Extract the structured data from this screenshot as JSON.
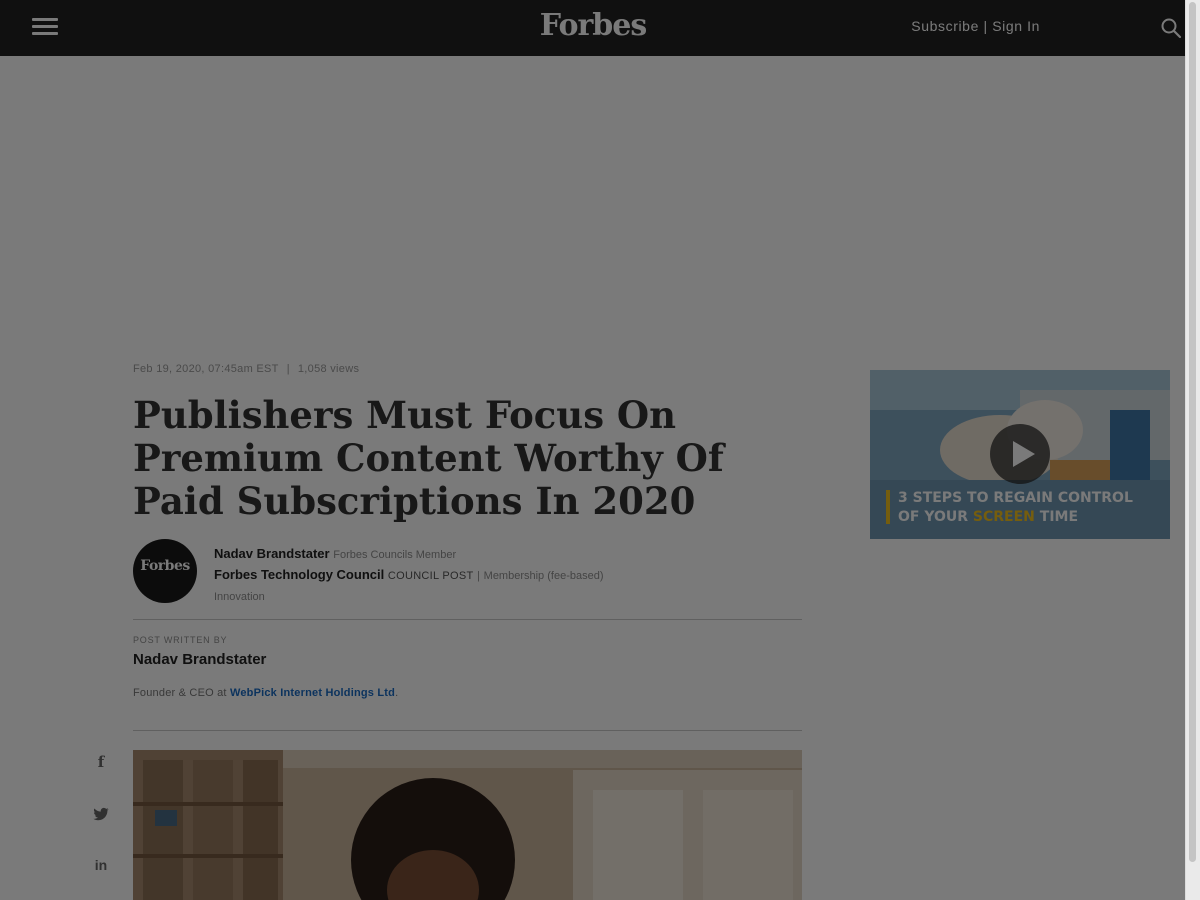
{
  "header": {
    "logo": "Forbes",
    "subscribe_label": "Subscribe",
    "auth_separator": "|",
    "signin_label": "Sign In"
  },
  "article": {
    "date": "Feb 19, 2020, 07:45am EST",
    "meta_separator": "|",
    "views": "1,058 views",
    "title": "Publishers Must Focus On Premium Content Worthy Of Paid Subscriptions In 2020",
    "author": {
      "avatar_logo": "Forbes",
      "name": "Nadav Brandstater",
      "role": "Forbes Councils Member",
      "council": "Forbes Technology Council",
      "post_type": "COUNCIL POST",
      "membership_separator": "|",
      "membership": "Membership (fee-based)",
      "channel": "Innovation"
    },
    "written_by_label": "POST WRITTEN BY",
    "written_by_name": "Nadav Brandstater",
    "bio_prefix": "Founder & CEO at",
    "bio_company": "WebPick Internet Holdings Ltd",
    "bio_suffix": "."
  },
  "video_ad": {
    "caption_line1": "3 STEPS TO REGAIN CONTROL",
    "caption_line2_prefix": "OF YOUR",
    "caption_line2_highlight": "SCREEN",
    "caption_line2_suffix": "TIME"
  },
  "icons": {
    "menu": "hamburger-icon",
    "search": "search-icon",
    "play": "play-icon",
    "facebook": "facebook-icon",
    "twitter": "twitter-icon",
    "linkedin": "linkedin-icon"
  },
  "colors": {
    "topbar": "#222222",
    "link": "#1a6cc4",
    "highlight": "#f4c21f"
  }
}
